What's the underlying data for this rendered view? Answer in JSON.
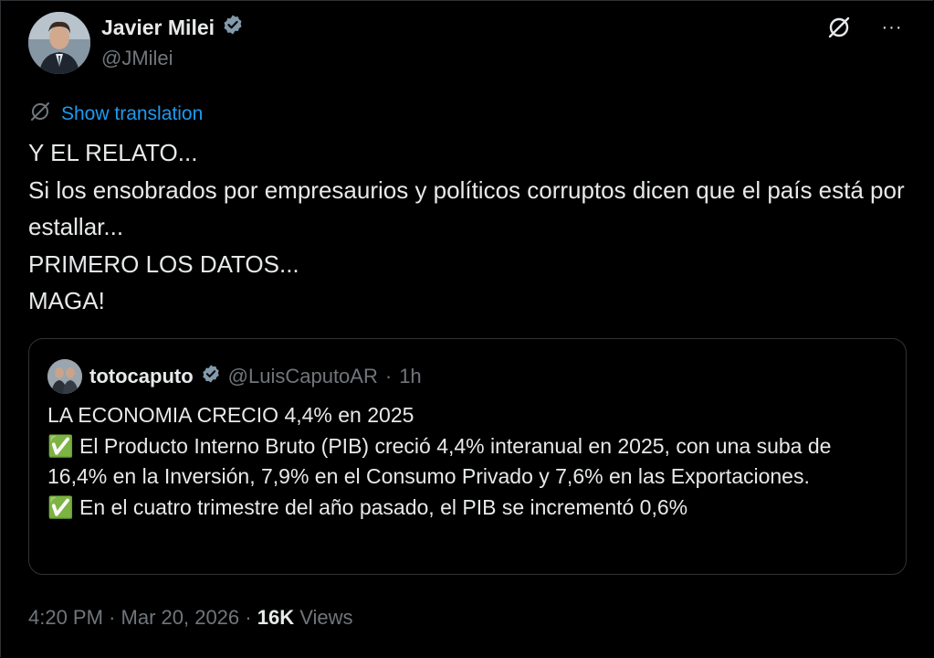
{
  "author": {
    "name": "Javier Milei",
    "handle": "@JMilei",
    "verified_icon": "verified-badge-icon"
  },
  "toolbar": {
    "icons": [
      "grok-icon",
      "more-icon"
    ],
    "more_label": "···"
  },
  "translation": {
    "label": "Show translation",
    "icon": "translate-icon"
  },
  "tweet": {
    "text": "Y EL RELATO...\nSi los ensobrados por empresaurios y políticos corruptos dicen que el país está por estallar...\nPRIMERO LOS DATOS...\nMAGA!"
  },
  "quote": {
    "name": "totocaputo",
    "handle": "@LuisCaputoAR",
    "separator": "·",
    "time": "1h",
    "text": "LA ECONOMIA CRECIO 4,4% en 2025\n✅ El Producto Interno Bruto (PIB) creció 4,4% interanual en 2025, con una suba de 16,4% en la Inversión, 7,9% en el Consumo Privado y 7,6% en las Exportaciones.\n✅ En el cuatro trimestre del año pasado, el PIB se incrementó 0,6%"
  },
  "meta": {
    "time": "4:20 PM",
    "sep1": "·",
    "date": "Mar 20, 2026",
    "sep2": "·",
    "views_count": "16K",
    "views_label": "Views"
  },
  "colors": {
    "background": "#000000",
    "text": "#e7e9ea",
    "muted": "#71767b",
    "link": "#1d9bf0",
    "border": "#2f3336"
  }
}
